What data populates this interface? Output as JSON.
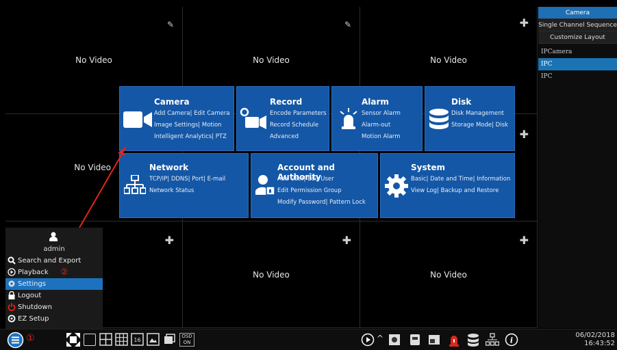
{
  "grid": {
    "no_video": "No Video"
  },
  "right_panel": {
    "buttons": [
      "Camera",
      "Single Channel Sequence",
      "Customize Layout"
    ],
    "list": [
      "IPCamera",
      "IPC",
      "IPC"
    ]
  },
  "settings": {
    "camera": {
      "title": "Camera",
      "line1": "Add Camera| Edit Camera",
      "line2": "Image Settings| Motion",
      "line3": "Intelligent Analytics| PTZ"
    },
    "record": {
      "title": "Record",
      "line1": "Encode Parameters",
      "line2": "Record Schedule",
      "line3": "Advanced"
    },
    "alarm": {
      "title": "Alarm",
      "line1": "Sensor Alarm",
      "line2": "Alarm-out",
      "line3": "Motion Alarm"
    },
    "disk": {
      "title": "Disk",
      "line1": "Disk Management",
      "line2": "Storage Mode| Disk"
    },
    "network": {
      "title": "Network",
      "line1": "TCP/IP| DDNS| Port| E-mail",
      "line2": "Network Status"
    },
    "account": {
      "title": "Account and Authority",
      "line1": "Add User| Edit User",
      "line2": "Edit Permission Group",
      "line3": "Modify Password| Pattern Lock"
    },
    "system": {
      "title": "System",
      "line1": "Basic| Date and Time| Information",
      "line2": "View Log| Backup and Restore"
    }
  },
  "start_menu": {
    "user": "admin",
    "items": [
      "Search and Export",
      "Playback",
      "Settings",
      "Logout",
      "Shutdown",
      "EZ Setup"
    ]
  },
  "annotations": {
    "one": "①",
    "two": "②"
  },
  "bottombar": {
    "osd_top": "OSD",
    "osd_bottom": "ON",
    "date": "06/02/2018",
    "time": "16:43:52"
  },
  "colors": {
    "accent": "#1457a6",
    "selected": "#1d72c0",
    "annotation": "#e0251a"
  }
}
